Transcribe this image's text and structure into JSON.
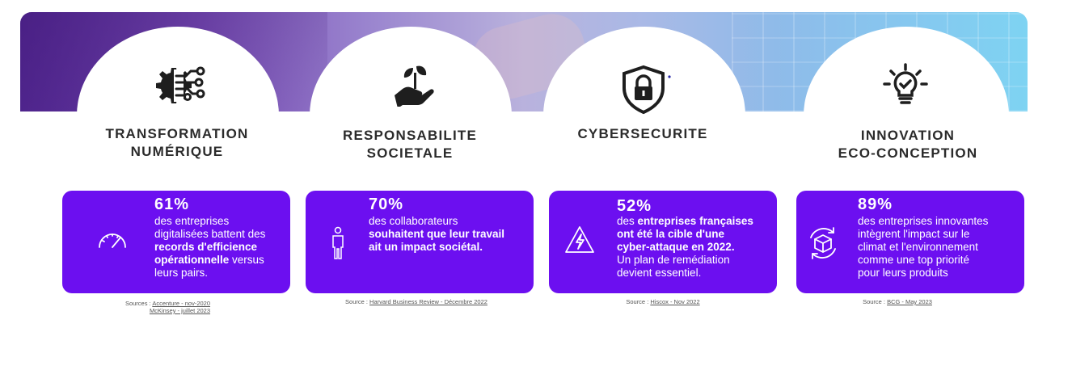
{
  "columns": [
    {
      "title_line1": "TRANSFORMATION",
      "title_line2": "NUMÉRIQUE",
      "icon": "gear-circuit-icon",
      "percent": "61%",
      "text_lines": [
        "des entreprises",
        "digitalisées battent des"
      ],
      "text_bold_1": "records d'efficience",
      "text_bold_2": "opérationnelle",
      "text_after_bold": " versus",
      "text_end": "leurs pairs.",
      "card_icon": "speedometer-icon",
      "source_label": "Sources : ",
      "source_link_1": "Accenture - nov-2020",
      "source_link_2": "McKinsey - juillet 2023"
    },
    {
      "title_line1": "RESPONSABILITE",
      "title_line2": "SOCIETALE",
      "icon": "hand-plant-icon",
      "percent": "70%",
      "text_line1": "des collaborateurs",
      "text_bold_1": "souhaitent que leur travail",
      "text_bold_2": "ait un impact sociétal.",
      "card_icon": "person-icon",
      "source_label": "Source : ",
      "source_link_1": "Harvard Business Review - Décembre 2022"
    },
    {
      "title_line1": "CYBERSECURITE",
      "icon": "shield-lock-icon",
      "percent": "52%",
      "text_pre": "des ",
      "text_bold_1": "entreprises françaises",
      "text_bold_2": "ont été la cible d'une",
      "text_bold_3": "cyber-attaque en 2022.",
      "text_line_4": "Un plan de remédiation",
      "text_line_5": "devient essentiel.",
      "card_icon": "warning-lightning-icon",
      "source_label": "Source : ",
      "source_link_1": "Hiscox - Nov 2022"
    },
    {
      "title_line1": "INNOVATION",
      "title_line2": "ECO-CONCEPTION",
      "icon": "lightbulb-check-icon",
      "percent": "89%",
      "text_lines": [
        "des entreprises innovantes",
        "intègrent l'impact sur le",
        "climat et l'environnement",
        "comme une top priorité",
        "pour leurs produits"
      ],
      "card_icon": "recycle-box-icon",
      "source_label": "Source : ",
      "source_link_1": "BCG - May 2023"
    }
  ],
  "colors": {
    "card": "#6c0ff0",
    "title": "#2b2b2b"
  }
}
